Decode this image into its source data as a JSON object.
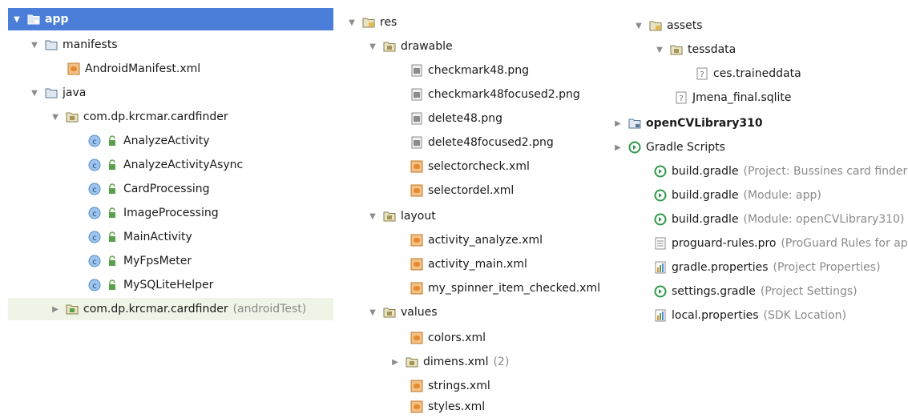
{
  "col1": {
    "app": "app",
    "manifests": "manifests",
    "android_manifest": "AndroidManifest.xml",
    "java": "java",
    "package_main": "com.dp.krcmar.cardfinder",
    "classes": [
      "AnalyzeActivity",
      "AnalyzeActivityAsync",
      "CardProcessing",
      "ImageProcessing",
      "MainActivity",
      "MyFpsMeter",
      "MySQLiteHelper"
    ],
    "package_test": "com.dp.krcmar.cardfinder",
    "package_test_hint": "(androidTest)"
  },
  "col2": {
    "res": "res",
    "drawable": "drawable",
    "drawable_files": [
      "checkmark48.png",
      "checkmark48focused2.png",
      "delete48.png",
      "delete48focused2.png",
      "selectorcheck.xml",
      "selectordel.xml"
    ],
    "layout": "layout",
    "layout_files": [
      "activity_analyze.xml",
      "activity_main.xml",
      "my_spinner_item_checked.xml"
    ],
    "values": "values",
    "colors": "colors.xml",
    "dimens": "dimens.xml",
    "dimens_hint": "(2)",
    "strings": "strings.xml",
    "styles": "styles.xml"
  },
  "col3": {
    "assets": "assets",
    "tessdata": "tessdata",
    "traineddata": "ces.traineddata",
    "sqlite": "Jmena_final.sqlite",
    "opencv": "openCVLibrary310",
    "gradle_scripts": "Gradle Scripts",
    "gradle_files": [
      {
        "name": "build.gradle",
        "hint": "(Project: Bussines card finder)"
      },
      {
        "name": "build.gradle",
        "hint": "(Module: app)"
      },
      {
        "name": "build.gradle",
        "hint": "(Module: openCVLibrary310)"
      },
      {
        "name": "proguard-rules.pro",
        "hint": "(ProGuard Rules for app)"
      },
      {
        "name": "gradle.properties",
        "hint": "(Project Properties)"
      },
      {
        "name": "settings.gradle",
        "hint": "(Project Settings)"
      },
      {
        "name": "local.properties",
        "hint": "(SDK Location)"
      }
    ]
  },
  "icons": {
    "folder": "folder-icon",
    "module_folder": "module-folder-icon",
    "package": "package-icon",
    "resource_folder": "resource-folder-icon",
    "class": "class-icon",
    "xml_file": "xml-file-icon",
    "image_file": "image-file-icon",
    "unknown_file": "unknown-file-icon",
    "gradle": "gradle-icon",
    "text_file": "text-file-icon",
    "properties_file": "properties-file-icon"
  },
  "colors": {
    "selection": "#4a7ed8",
    "highlight": "#eef5e6",
    "hint": "#8a8a8a",
    "folder_fill": "#dfe7f0",
    "folder_stroke": "#5b7897",
    "class_circle": "#4d8ed6",
    "gradle_green": "#2f9a4a",
    "xml_orange": "#e58a2e"
  }
}
